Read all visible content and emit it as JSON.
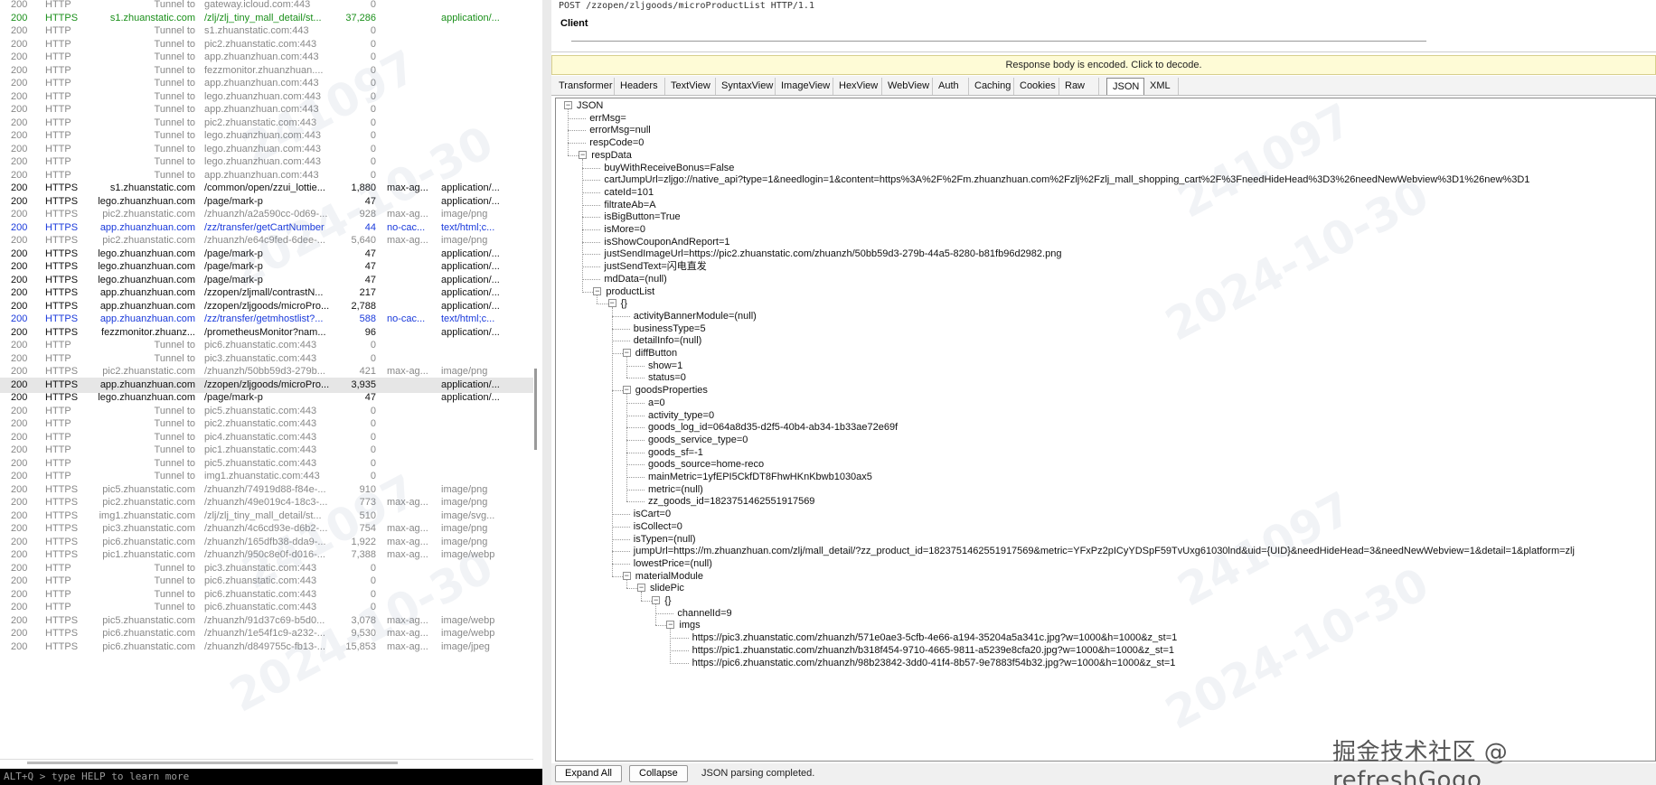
{
  "sessions": [
    {
      "result": "200",
      "protocol": "HTTP",
      "host": "Tunnel to",
      "url": "gateway.icloud.com:443",
      "body": "0",
      "caching": "",
      "ctype": "",
      "color": "grey"
    },
    {
      "result": "200",
      "protocol": "HTTPS",
      "host": "s1.zhuanstatic.com",
      "url": "/zlj/zlj_tiny_mall_detail/st...",
      "body": "37,286",
      "caching": "",
      "ctype": "application/...",
      "color": "green"
    },
    {
      "result": "200",
      "protocol": "HTTP",
      "host": "Tunnel to",
      "url": "s1.zhuanstatic.com:443",
      "body": "0",
      "caching": "",
      "ctype": "",
      "color": "grey"
    },
    {
      "result": "200",
      "protocol": "HTTP",
      "host": "Tunnel to",
      "url": "pic2.zhuanstatic.com:443",
      "body": "0",
      "caching": "",
      "ctype": "",
      "color": "grey"
    },
    {
      "result": "200",
      "protocol": "HTTP",
      "host": "Tunnel to",
      "url": "app.zhuanzhuan.com:443",
      "body": "0",
      "caching": "",
      "ctype": "",
      "color": "grey"
    },
    {
      "result": "200",
      "protocol": "HTTP",
      "host": "Tunnel to",
      "url": "fezzmonitor.zhuanzhuan....",
      "body": "0",
      "caching": "",
      "ctype": "",
      "color": "grey"
    },
    {
      "result": "200",
      "protocol": "HTTP",
      "host": "Tunnel to",
      "url": "app.zhuanzhuan.com:443",
      "body": "0",
      "caching": "",
      "ctype": "",
      "color": "grey"
    },
    {
      "result": "200",
      "protocol": "HTTP",
      "host": "Tunnel to",
      "url": "lego.zhuanzhuan.com:443",
      "body": "0",
      "caching": "",
      "ctype": "",
      "color": "grey"
    },
    {
      "result": "200",
      "protocol": "HTTP",
      "host": "Tunnel to",
      "url": "app.zhuanzhuan.com:443",
      "body": "0",
      "caching": "",
      "ctype": "",
      "color": "grey"
    },
    {
      "result": "200",
      "protocol": "HTTP",
      "host": "Tunnel to",
      "url": "pic2.zhuanstatic.com:443",
      "body": "0",
      "caching": "",
      "ctype": "",
      "color": "grey"
    },
    {
      "result": "200",
      "protocol": "HTTP",
      "host": "Tunnel to",
      "url": "lego.zhuanzhuan.com:443",
      "body": "0",
      "caching": "",
      "ctype": "",
      "color": "grey"
    },
    {
      "result": "200",
      "protocol": "HTTP",
      "host": "Tunnel to",
      "url": "lego.zhuanzhuan.com:443",
      "body": "0",
      "caching": "",
      "ctype": "",
      "color": "grey"
    },
    {
      "result": "200",
      "protocol": "HTTP",
      "host": "Tunnel to",
      "url": "lego.zhuanzhuan.com:443",
      "body": "0",
      "caching": "",
      "ctype": "",
      "color": "grey"
    },
    {
      "result": "200",
      "protocol": "HTTP",
      "host": "Tunnel to",
      "url": "app.zhuanzhuan.com:443",
      "body": "0",
      "caching": "",
      "ctype": "",
      "color": "grey"
    },
    {
      "result": "200",
      "protocol": "HTTPS",
      "host": "s1.zhuanstatic.com",
      "url": "/common/open/zzui_lottie...",
      "body": "1,880",
      "caching": "max-ag...",
      "ctype": "application/...",
      "color": "black"
    },
    {
      "result": "200",
      "protocol": "HTTPS",
      "host": "lego.zhuanzhuan.com",
      "url": "/page/mark-p",
      "body": "47",
      "caching": "",
      "ctype": "application/...",
      "color": "black"
    },
    {
      "result": "200",
      "protocol": "HTTPS",
      "host": "pic2.zhuanstatic.com",
      "url": "/zhuanzh/a2a590cc-0d69-...",
      "body": "928",
      "caching": "max-ag...",
      "ctype": "image/png",
      "color": "grey"
    },
    {
      "result": "200",
      "protocol": "HTTPS",
      "host": "app.zhuanzhuan.com",
      "url": "/zz/transfer/getCartNumber",
      "body": "44",
      "caching": "no-cac...",
      "ctype": "text/html;c...",
      "color": "blue"
    },
    {
      "result": "200",
      "protocol": "HTTPS",
      "host": "pic2.zhuanstatic.com",
      "url": "/zhuanzh/e64c9fed-6dee-...",
      "body": "5,640",
      "caching": "max-ag...",
      "ctype": "image/png",
      "color": "grey"
    },
    {
      "result": "200",
      "protocol": "HTTPS",
      "host": "lego.zhuanzhuan.com",
      "url": "/page/mark-p",
      "body": "47",
      "caching": "",
      "ctype": "application/...",
      "color": "black"
    },
    {
      "result": "200",
      "protocol": "HTTPS",
      "host": "lego.zhuanzhuan.com",
      "url": "/page/mark-p",
      "body": "47",
      "caching": "",
      "ctype": "application/...",
      "color": "black"
    },
    {
      "result": "200",
      "protocol": "HTTPS",
      "host": "lego.zhuanzhuan.com",
      "url": "/page/mark-p",
      "body": "47",
      "caching": "",
      "ctype": "application/...",
      "color": "black"
    },
    {
      "result": "200",
      "protocol": "HTTPS",
      "host": "app.zhuanzhuan.com",
      "url": "/zzopen/zljmall/contrastN...",
      "body": "217",
      "caching": "",
      "ctype": "application/...",
      "color": "black"
    },
    {
      "result": "200",
      "protocol": "HTTPS",
      "host": "app.zhuanzhuan.com",
      "url": "/zzopen/zljgoods/microPro...",
      "body": "2,788",
      "caching": "",
      "ctype": "application/...",
      "color": "black"
    },
    {
      "result": "200",
      "protocol": "HTTPS",
      "host": "app.zhuanzhuan.com",
      "url": "/zz/transfer/getmhostlist?...",
      "body": "588",
      "caching": "no-cac...",
      "ctype": "text/html;c...",
      "color": "blue"
    },
    {
      "result": "200",
      "protocol": "HTTPS",
      "host": "fezzmonitor.zhuanz...",
      "url": "/prometheusMonitor?nam...",
      "body": "96",
      "caching": "",
      "ctype": "application/...",
      "color": "black"
    },
    {
      "result": "200",
      "protocol": "HTTP",
      "host": "Tunnel to",
      "url": "pic6.zhuanstatic.com:443",
      "body": "0",
      "caching": "",
      "ctype": "",
      "color": "grey"
    },
    {
      "result": "200",
      "protocol": "HTTP",
      "host": "Tunnel to",
      "url": "pic3.zhuanstatic.com:443",
      "body": "0",
      "caching": "",
      "ctype": "",
      "color": "grey"
    },
    {
      "result": "200",
      "protocol": "HTTPS",
      "host": "pic2.zhuanstatic.com",
      "url": "/zhuanzh/50bb59d3-279b...",
      "body": "421",
      "caching": "max-ag...",
      "ctype": "image/png",
      "color": "grey"
    },
    {
      "result": "200",
      "protocol": "HTTPS",
      "host": "app.zhuanzhuan.com",
      "url": "/zzopen/zljgoods/microPro...",
      "body": "3,935",
      "caching": "",
      "ctype": "application/...",
      "color": "black",
      "selected": true
    },
    {
      "result": "200",
      "protocol": "HTTPS",
      "host": "lego.zhuanzhuan.com",
      "url": "/page/mark-p",
      "body": "47",
      "caching": "",
      "ctype": "application/...",
      "color": "black"
    },
    {
      "result": "200",
      "protocol": "HTTP",
      "host": "Tunnel to",
      "url": "pic5.zhuanstatic.com:443",
      "body": "0",
      "caching": "",
      "ctype": "",
      "color": "grey"
    },
    {
      "result": "200",
      "protocol": "HTTP",
      "host": "Tunnel to",
      "url": "pic2.zhuanstatic.com:443",
      "body": "0",
      "caching": "",
      "ctype": "",
      "color": "grey"
    },
    {
      "result": "200",
      "protocol": "HTTP",
      "host": "Tunnel to",
      "url": "pic4.zhuanstatic.com:443",
      "body": "0",
      "caching": "",
      "ctype": "",
      "color": "grey"
    },
    {
      "result": "200",
      "protocol": "HTTP",
      "host": "Tunnel to",
      "url": "pic1.zhuanstatic.com:443",
      "body": "0",
      "caching": "",
      "ctype": "",
      "color": "grey"
    },
    {
      "result": "200",
      "protocol": "HTTP",
      "host": "Tunnel to",
      "url": "pic5.zhuanstatic.com:443",
      "body": "0",
      "caching": "",
      "ctype": "",
      "color": "grey"
    },
    {
      "result": "200",
      "protocol": "HTTP",
      "host": "Tunnel to",
      "url": "img1.zhuanstatic.com:443",
      "body": "0",
      "caching": "",
      "ctype": "",
      "color": "grey"
    },
    {
      "result": "200",
      "protocol": "HTTPS",
      "host": "pic5.zhuanstatic.com",
      "url": "/zhuanzh/74919d88-f84e-...",
      "body": "910",
      "caching": "",
      "ctype": "image/png",
      "color": "grey"
    },
    {
      "result": "200",
      "protocol": "HTTPS",
      "host": "pic2.zhuanstatic.com",
      "url": "/zhuanzh/49e019c4-18c3-...",
      "body": "773",
      "caching": "max-ag...",
      "ctype": "image/png",
      "color": "grey"
    },
    {
      "result": "200",
      "protocol": "HTTPS",
      "host": "img1.zhuanstatic.com",
      "url": "/zlj/zlj_tiny_mall_detail/st...",
      "body": "510",
      "caching": "",
      "ctype": "image/svg...",
      "color": "grey"
    },
    {
      "result": "200",
      "protocol": "HTTPS",
      "host": "pic3.zhuanstatic.com",
      "url": "/zhuanzh/4c6cd93e-d6b2-...",
      "body": "754",
      "caching": "max-ag...",
      "ctype": "image/png",
      "color": "grey"
    },
    {
      "result": "200",
      "protocol": "HTTPS",
      "host": "pic6.zhuanstatic.com",
      "url": "/zhuanzh/165dfb38-dda9-...",
      "body": "1,922",
      "caching": "max-ag...",
      "ctype": "image/png",
      "color": "grey"
    },
    {
      "result": "200",
      "protocol": "HTTPS",
      "host": "pic1.zhuanstatic.com",
      "url": "/zhuanzh/950c8e0f-d016-...",
      "body": "7,388",
      "caching": "max-ag...",
      "ctype": "image/webp",
      "color": "grey"
    },
    {
      "result": "200",
      "protocol": "HTTP",
      "host": "Tunnel to",
      "url": "pic3.zhuanstatic.com:443",
      "body": "0",
      "caching": "",
      "ctype": "",
      "color": "grey"
    },
    {
      "result": "200",
      "protocol": "HTTP",
      "host": "Tunnel to",
      "url": "pic6.zhuanstatic.com:443",
      "body": "0",
      "caching": "",
      "ctype": "",
      "color": "grey"
    },
    {
      "result": "200",
      "protocol": "HTTP",
      "host": "Tunnel to",
      "url": "pic6.zhuanstatic.com:443",
      "body": "0",
      "caching": "",
      "ctype": "",
      "color": "grey"
    },
    {
      "result": "200",
      "protocol": "HTTP",
      "host": "Tunnel to",
      "url": "pic6.zhuanstatic.com:443",
      "body": "0",
      "caching": "",
      "ctype": "",
      "color": "grey"
    },
    {
      "result": "200",
      "protocol": "HTTPS",
      "host": "pic5.zhuanstatic.com",
      "url": "/zhuanzh/91d37c69-b5d0...",
      "body": "3,078",
      "caching": "max-ag...",
      "ctype": "image/webp",
      "color": "grey"
    },
    {
      "result": "200",
      "protocol": "HTTPS",
      "host": "pic6.zhuanstatic.com",
      "url": "/zhuanzh/1e54f1c9-a232-...",
      "body": "9,530",
      "caching": "max-ag...",
      "ctype": "image/webp",
      "color": "grey"
    },
    {
      "result": "200",
      "protocol": "HTTPS",
      "host": "pic6.zhuanstatic.com",
      "url": "/zhuanzh/d849755c-fb13-...",
      "body": "15,853",
      "caching": "max-ag...",
      "ctype": "image/jpeg",
      "color": "grey"
    }
  ],
  "quickexec": "ALT+Q > type HELP to learn more",
  "request": {
    "line": "POST /zzopen/zljgoods/microProductList HTTP/1.1",
    "client_label": "Client"
  },
  "response": {
    "encoded_notice": "Response body is encoded. Click to decode.",
    "tabs": [
      "Transformer",
      "Headers",
      "TextView",
      "SyntaxView",
      "ImageView",
      "HexView",
      "WebView",
      "Auth",
      "Caching",
      "Cookies",
      "Raw",
      "JSON",
      "XML"
    ],
    "active_tab": "JSON",
    "tree": [
      {
        "d": 0,
        "t": "JSON",
        "box": "-"
      },
      {
        "d": 1,
        "t": "errMsg="
      },
      {
        "d": 1,
        "t": "errorMsg=null"
      },
      {
        "d": 1,
        "t": "respCode=0"
      },
      {
        "d": 1,
        "t": "respData",
        "box": "-"
      },
      {
        "d": 2,
        "t": "buyWithReceiveBonus=False"
      },
      {
        "d": 2,
        "t": "cartJumpUrl=zljgo://native_api?type=1&needlogin=1&content=https%3A%2F%2Fm.zhuanzhuan.com%2Fzlj%2Fzlj_mall_shopping_cart%2F%3FneedHideHead%3D3%26needNewWebview%3D1%26new%3D1"
      },
      {
        "d": 2,
        "t": "cateId=101"
      },
      {
        "d": 2,
        "t": "filtrateAb=A"
      },
      {
        "d": 2,
        "t": "isBigButton=True"
      },
      {
        "d": 2,
        "t": "isMore=0"
      },
      {
        "d": 2,
        "t": "isShowCouponAndReport=1"
      },
      {
        "d": 2,
        "t": "justSendImageUrl=https://pic2.zhuanstatic.com/zhuanzh/50bb59d3-279b-44a5-8280-b81fb96d2982.png"
      },
      {
        "d": 2,
        "t": "justSendText=闪电直发"
      },
      {
        "d": 2,
        "t": "mdData=(null)"
      },
      {
        "d": 2,
        "t": "productList",
        "box": "-"
      },
      {
        "d": 3,
        "t": "{}",
        "box": "-"
      },
      {
        "d": 4,
        "t": "activityBannerModule=(null)"
      },
      {
        "d": 4,
        "t": "businessType=5"
      },
      {
        "d": 4,
        "t": "detailInfo=(null)"
      },
      {
        "d": 4,
        "t": "diffButton",
        "box": "-"
      },
      {
        "d": 5,
        "t": "show=1"
      },
      {
        "d": 5,
        "t": "status=0"
      },
      {
        "d": 4,
        "t": "goodsProperties",
        "box": "-"
      },
      {
        "d": 5,
        "t": "a=0"
      },
      {
        "d": 5,
        "t": "activity_type=0"
      },
      {
        "d": 5,
        "t": "goods_log_id=064a8d35-d2f5-40b4-ab34-1b33ae72e69f"
      },
      {
        "d": 5,
        "t": "goods_service_type=0"
      },
      {
        "d": 5,
        "t": "goods_sf=-1"
      },
      {
        "d": 5,
        "t": "goods_source=home-reco"
      },
      {
        "d": 5,
        "t": "mainMetric=1yfEPI5CkfDT8FhwHKnKbwb1030ax5"
      },
      {
        "d": 5,
        "t": "metric=(null)"
      },
      {
        "d": 5,
        "t": "zz_goods_id=1823751462551917569"
      },
      {
        "d": 4,
        "t": "isCart=0"
      },
      {
        "d": 4,
        "t": "isCollect=0"
      },
      {
        "d": 4,
        "t": "isTypen=(null)"
      },
      {
        "d": 4,
        "t": "jumpUrl=https://m.zhuanzhuan.com/zlj/mall_detail/?zz_product_id=1823751462551917569&metric=YFxPz2pICyYDSpF59TvUxg61030lnd&uid={UID}&needHideHead=3&needNewWebview=1&detail=1&platform=zlj"
      },
      {
        "d": 4,
        "t": "lowestPrice=(null)"
      },
      {
        "d": 4,
        "t": "materialModule",
        "box": "-"
      },
      {
        "d": 5,
        "t": "slidePic",
        "box": "-"
      },
      {
        "d": 6,
        "t": "{}",
        "box": "-"
      },
      {
        "d": 7,
        "t": "channelId=9"
      },
      {
        "d": 7,
        "t": "imgs",
        "box": "-"
      },
      {
        "d": 8,
        "t": "https://pic3.zhuanstatic.com/zhuanzh/571e0ae3-5cfb-4e66-a194-35204a5a341c.jpg?w=1000&h=1000&z_st=1"
      },
      {
        "d": 8,
        "t": "https://pic1.zhuanstatic.com/zhuanzh/b318f454-9710-4665-9811-a5239e8cfa20.jpg?w=1000&h=1000&z_st=1"
      },
      {
        "d": 8,
        "t": "https://pic6.zhuanstatic.com/zhuanzh/98b23842-3dd0-41f4-8b57-9e7883f54b32.jpg?w=1000&h=1000&z_st=1"
      }
    ]
  },
  "bottom": {
    "expand_all": "Expand All",
    "collapse": "Collapse",
    "status": "JSON parsing completed."
  },
  "watermark": [
    "241097",
    "2024-10-30"
  ],
  "credit": "掘金技术社区 @ refreshGogo",
  "colors": {
    "green": "#1a8f1a",
    "blue": "#1a3adb",
    "grey": "#888888",
    "selected_row": "#e6e6e6",
    "notice_bg": "#fefbd6"
  }
}
